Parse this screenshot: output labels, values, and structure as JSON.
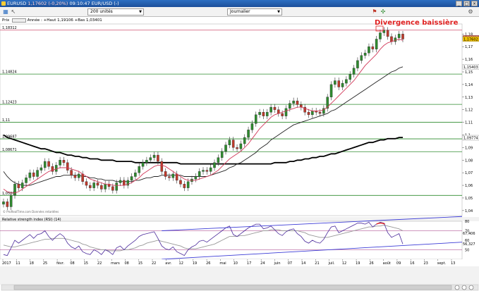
{
  "window": {
    "title_symbol": "EURUSD",
    "title_price": "1,17602",
    "title_change": "(-0,20%)",
    "title_time": "09:10:47 EUR/USD (-)",
    "minimize": "_",
    "restore": "□",
    "close": "×"
  },
  "toolbar": {
    "units_value": "200 unités",
    "period_value": "Journalier"
  },
  "price_panel": {
    "label": "Prix",
    "info": "Année : +Haut 1,19106 +Bas 1,03401",
    "watermark": "© ProRealTime.com  Données retardées"
  },
  "rsi_panel": {
    "title": "Relative strength index (RSI) (14)"
  },
  "colors": {
    "candle_up": "#2e8b2e",
    "candle_down": "#c0392b",
    "ma_short": "#d23a5a",
    "ma_mid": "#222222",
    "ma_long": "#000000",
    "rsi_line": "#4b2a9b",
    "rsi_signal": "#999999",
    "trend_line": "#3b3bd6",
    "hline": "#2e8b2e",
    "annotation": "#e02020"
  },
  "chart_data": {
    "type": "candlestick",
    "title": "",
    "annotation": "Divergence baissière",
    "ylim": [
      1.036,
      1.188
    ],
    "y_ticks": [
      "1,18",
      "1,17",
      "1,16",
      "1,15",
      "1,14",
      "1,13",
      "1,12",
      "1,11",
      "1,1",
      "1,09",
      "1,08",
      "1,07",
      "1,06",
      "1,05",
      "1,04"
    ],
    "y_tick_values": [
      1.18,
      1.17,
      1.16,
      1.15,
      1.14,
      1.13,
      1.12,
      1.11,
      1.1,
      1.09,
      1.08,
      1.07,
      1.06,
      1.05,
      1.04
    ],
    "horizontal_levels": [
      {
        "label": "1,18312",
        "value": 1.18312,
        "color": "#d05070"
      },
      {
        "label": "1,14824",
        "value": 1.14824,
        "color": "#2e8b2e"
      },
      {
        "label": "1,12423",
        "value": 1.12423,
        "color": "#2e8b2e"
      },
      {
        "label": "1,11",
        "value": 1.11,
        "color": "#2e8b2e"
      },
      {
        "label": "1,09687",
        "value": 1.09687,
        "color": "#2e8b2e"
      },
      {
        "label": "1,08671",
        "value": 1.08671,
        "color": "#2e8b2e"
      },
      {
        "label": "1,05202",
        "value": 1.05202,
        "color": "#2e8b2e"
      }
    ],
    "price_labels": [
      {
        "label": "1,17697",
        "value": 1.17697,
        "color": "#c0392b"
      },
      {
        "label": "1,17602",
        "value": 1.17602,
        "color": "#f0c000"
      },
      {
        "label": "1,15403",
        "value": 1.15403,
        "color": "#ffffff"
      },
      {
        "label": "1,09774",
        "value": 1.09774,
        "color": "#ffffff"
      }
    ],
    "x_ticks": [
      "2017",
      "11",
      "18",
      "25",
      "févr.",
      "08",
      "15",
      "22",
      "mars",
      "08",
      "15",
      "22",
      "avr.",
      "12",
      "19",
      "26",
      "mai",
      "10",
      "17",
      "24",
      "juin",
      "07",
      "14",
      "21",
      "juil.",
      "12",
      "19",
      "26",
      "août",
      "09",
      "16",
      "23",
      "sept.",
      "13"
    ],
    "close": [
      1.047,
      1.043,
      1.052,
      1.061,
      1.058,
      1.062,
      1.066,
      1.07,
      1.067,
      1.072,
      1.074,
      1.079,
      1.075,
      1.071,
      1.076,
      1.08,
      1.078,
      1.072,
      1.068,
      1.066,
      1.069,
      1.063,
      1.06,
      1.058,
      1.062,
      1.06,
      1.057,
      1.061,
      1.059,
      1.056,
      1.062,
      1.064,
      1.06,
      1.064,
      1.067,
      1.07,
      1.075,
      1.078,
      1.08,
      1.082,
      1.084,
      1.079,
      1.071,
      1.067,
      1.066,
      1.069,
      1.064,
      1.061,
      1.058,
      1.063,
      1.065,
      1.067,
      1.071,
      1.072,
      1.071,
      1.074,
      1.078,
      1.082,
      1.087,
      1.092,
      1.096,
      1.09,
      1.089,
      1.093,
      1.098,
      1.104,
      1.109,
      1.116,
      1.118,
      1.115,
      1.118,
      1.122,
      1.12,
      1.117,
      1.115,
      1.121,
      1.125,
      1.127,
      1.124,
      1.122,
      1.118,
      1.116,
      1.119,
      1.118,
      1.117,
      1.121,
      1.13,
      1.14,
      1.143,
      1.138,
      1.141,
      1.144,
      1.148,
      1.153,
      1.159,
      1.163,
      1.165,
      1.17,
      1.168,
      1.176,
      1.181,
      1.183,
      1.178,
      1.174,
      1.177,
      1.18,
      1.176
    ],
    "ma_short": [
      1.057,
      1.055,
      1.054,
      1.054,
      1.055,
      1.057,
      1.059,
      1.061,
      1.063,
      1.065,
      1.067,
      1.069,
      1.071,
      1.072,
      1.073,
      1.074,
      1.074,
      1.074,
      1.073,
      1.072,
      1.071,
      1.069,
      1.067,
      1.065,
      1.064,
      1.063,
      1.062,
      1.061,
      1.061,
      1.06,
      1.06,
      1.06,
      1.06,
      1.061,
      1.062,
      1.064,
      1.066,
      1.069,
      1.071,
      1.073,
      1.075,
      1.076,
      1.076,
      1.075,
      1.073,
      1.071,
      1.069,
      1.067,
      1.065,
      1.064,
      1.064,
      1.064,
      1.065,
      1.066,
      1.067,
      1.068,
      1.07,
      1.072,
      1.075,
      1.078,
      1.081,
      1.083,
      1.085,
      1.087,
      1.09,
      1.093,
      1.097,
      1.101,
      1.105,
      1.108,
      1.111,
      1.114,
      1.116,
      1.117,
      1.118,
      1.119,
      1.12,
      1.121,
      1.122,
      1.122,
      1.121,
      1.12,
      1.119,
      1.119,
      1.119,
      1.12,
      1.122,
      1.125,
      1.128,
      1.131,
      1.134,
      1.137,
      1.14,
      1.143,
      1.147,
      1.151,
      1.155,
      1.158,
      1.161,
      1.164,
      1.168,
      1.171,
      1.173,
      1.174,
      1.175,
      1.176,
      1.175
    ],
    "ma_mid": [
      1.071,
      1.067,
      1.064,
      1.062,
      1.061,
      1.06,
      1.06,
      1.06,
      1.061,
      1.062,
      1.063,
      1.064,
      1.065,
      1.066,
      1.067,
      1.067,
      1.068,
      1.068,
      1.068,
      1.068,
      1.068,
      1.067,
      1.067,
      1.066,
      1.066,
      1.065,
      1.065,
      1.064,
      1.064,
      1.064,
      1.063,
      1.063,
      1.063,
      1.063,
      1.063,
      1.064,
      1.064,
      1.065,
      1.066,
      1.066,
      1.067,
      1.067,
      1.068,
      1.068,
      1.068,
      1.068,
      1.068,
      1.068,
      1.067,
      1.067,
      1.067,
      1.067,
      1.067,
      1.067,
      1.067,
      1.068,
      1.069,
      1.07,
      1.071,
      1.072,
      1.074,
      1.075,
      1.077,
      1.078,
      1.08,
      1.082,
      1.084,
      1.086,
      1.089,
      1.091,
      1.093,
      1.096,
      1.098,
      1.1,
      1.102,
      1.104,
      1.106,
      1.108,
      1.109,
      1.11,
      1.111,
      1.112,
      1.113,
      1.114,
      1.115,
      1.116,
      1.117,
      1.119,
      1.12,
      1.122,
      1.124,
      1.126,
      1.128,
      1.13,
      1.132,
      1.134,
      1.136,
      1.138,
      1.14,
      1.142,
      1.144,
      1.146,
      1.148,
      1.15,
      1.151,
      1.153,
      1.154
    ],
    "ma_long": [
      1.1,
      1.098,
      1.097,
      1.096,
      1.095,
      1.094,
      1.093,
      1.092,
      1.091,
      1.09,
      1.089,
      1.089,
      1.088,
      1.087,
      1.086,
      1.086,
      1.085,
      1.084,
      1.084,
      1.083,
      1.083,
      1.082,
      1.082,
      1.081,
      1.081,
      1.081,
      1.08,
      1.08,
      1.08,
      1.08,
      1.079,
      1.079,
      1.079,
      1.079,
      1.079,
      1.078,
      1.078,
      1.078,
      1.078,
      1.078,
      1.078,
      1.078,
      1.078,
      1.078,
      1.078,
      1.078,
      1.078,
      1.077,
      1.077,
      1.077,
      1.077,
      1.077,
      1.077,
      1.077,
      1.077,
      1.077,
      1.077,
      1.077,
      1.077,
      1.077,
      1.077,
      1.077,
      1.077,
      1.077,
      1.077,
      1.077,
      1.077,
      1.077,
      1.077,
      1.077,
      1.077,
      1.077,
      1.078,
      1.078,
      1.078,
      1.078,
      1.079,
      1.079,
      1.08,
      1.08,
      1.081,
      1.081,
      1.082,
      1.082,
      1.083,
      1.083,
      1.084,
      1.085,
      1.085,
      1.086,
      1.087,
      1.088,
      1.089,
      1.09,
      1.091,
      1.092,
      1.093,
      1.094,
      1.094,
      1.095,
      1.096,
      1.096,
      1.097,
      1.097,
      1.097,
      1.098,
      1.098
    ],
    "rsi_ylim": [
      40,
      80
    ],
    "rsi_ticks": [
      "80",
      "70",
      "60",
      "50"
    ],
    "rsi_tick_values": [
      80,
      70,
      60,
      50
    ],
    "rsi_labels": [
      {
        "label": "67,406",
        "value": 67.4
      },
      {
        "label": "56,327",
        "value": 56.3
      }
    ],
    "rsi_levels": [
      70,
      50
    ],
    "rsi": [
      45,
      44,
      52,
      60,
      57,
      60,
      63,
      66,
      62,
      66,
      67,
      70,
      64,
      60,
      64,
      67,
      64,
      57,
      53,
      51,
      54,
      48,
      46,
      45,
      50,
      48,
      45,
      50,
      48,
      45,
      52,
      54,
      50,
      54,
      57,
      60,
      64,
      66,
      67,
      68,
      69,
      62,
      54,
      51,
      50,
      53,
      48,
      46,
      44,
      50,
      53,
      55,
      59,
      60,
      58,
      61,
      64,
      67,
      70,
      73,
      75,
      66,
      64,
      67,
      70,
      73,
      75,
      77,
      77,
      72,
      73,
      75,
      71,
      67,
      65,
      69,
      71,
      72,
      67,
      64,
      59,
      57,
      60,
      58,
      57,
      61,
      68,
      74,
      75,
      68,
      70,
      72,
      74,
      76,
      78,
      78,
      77,
      79,
      74,
      77,
      79,
      78,
      68,
      63,
      65,
      67,
      56
    ],
    "rsi_signal": [
      55,
      54,
      53,
      53,
      54,
      55,
      56,
      57,
      58,
      59,
      60,
      61,
      61,
      62,
      62,
      62,
      62,
      61,
      60,
      59,
      58,
      56,
      55,
      53,
      52,
      51,
      50,
      50,
      49,
      49,
      49,
      49,
      50,
      50,
      51,
      52,
      54,
      55,
      57,
      58,
      59,
      60,
      59,
      58,
      57,
      56,
      55,
      54,
      52,
      51,
      51,
      51,
      52,
      53,
      54,
      55,
      56,
      58,
      60,
      62,
      64,
      64,
      64,
      65,
      65,
      66,
      67,
      68,
      69,
      70,
      70,
      71,
      71,
      71,
      70,
      70,
      70,
      70,
      70,
      69,
      68,
      66,
      65,
      64,
      63,
      63,
      63,
      64,
      65,
      66,
      67,
      68,
      69,
      70,
      71,
      72,
      73,
      74,
      74,
      75,
      75,
      76,
      75,
      74,
      73,
      72,
      70
    ],
    "rsi_trendlines": [
      {
        "from": [
          42,
          70
        ],
        "to": [
          106,
          85
        ]
      },
      {
        "from": [
          42,
          40
        ],
        "to": [
          106,
          58
        ]
      }
    ]
  }
}
